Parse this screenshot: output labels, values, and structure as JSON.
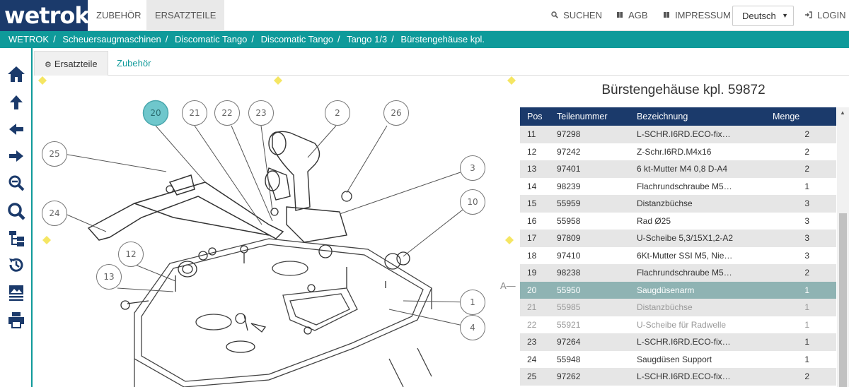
{
  "header": {
    "logo": "wetrok",
    "logo_mark": "®",
    "nav": [
      {
        "label": "ZUBEHÖR",
        "active": false
      },
      {
        "label": "ERSATZTEILE",
        "active": true
      }
    ],
    "links": [
      {
        "label": "SUCHEN",
        "icon": "search-icon"
      },
      {
        "label": "AGB",
        "icon": "book-icon"
      },
      {
        "label": "IMPRESSUM",
        "icon": "book-icon"
      },
      {
        "label": "LOGIN",
        "icon": "login-icon"
      }
    ],
    "language": "Deutsch"
  },
  "breadcrumb": [
    "WETROK",
    "Scheuersaugmaschinen",
    "Discomatic Tango",
    "Discomatic Tango",
    "Tango 1/3",
    "Bürstengehäuse kpl."
  ],
  "sidebar_icons": [
    "home-icon",
    "arrow-up-icon",
    "arrow-left-icon",
    "arrow-right-icon",
    "zoom-out-icon",
    "zoom-in-icon",
    "tree-icon",
    "history-icon",
    "image-list-icon",
    "print-icon"
  ],
  "subtabs": [
    {
      "label": "Ersatzteile",
      "icon": "gear-icon",
      "active": true
    },
    {
      "label": "Zubehör",
      "active": false
    }
  ],
  "drawing": {
    "callouts": [
      "20",
      "21",
      "22",
      "23",
      "2",
      "26",
      "25",
      "3",
      "24",
      "10",
      "12",
      "13",
      "1",
      "4"
    ],
    "selected": "20",
    "side_marker": "A—"
  },
  "parts": {
    "title": "Bürstengehäuse kpl. 59872",
    "columns": [
      "Pos",
      "Teilenummer",
      "Bezeichnung",
      "Menge"
    ],
    "rows": [
      {
        "pos": "11",
        "nr": "97298",
        "name": "L-SCHR.I6RD.ECO-fix…",
        "qty": "2",
        "state": "normal"
      },
      {
        "pos": "12",
        "nr": "97242",
        "name": "Z-Schr.I6RD.M4x16",
        "qty": "2",
        "state": "normal"
      },
      {
        "pos": "13",
        "nr": "97401",
        "name": "6 kt-Mutter M4 0,8 D-A4",
        "qty": "2",
        "state": "normal"
      },
      {
        "pos": "14",
        "nr": "98239",
        "name": "Flachrundschraube M5…",
        "qty": "1",
        "state": "normal"
      },
      {
        "pos": "15",
        "nr": "55959",
        "name": "Distanzbüchse",
        "qty": "3",
        "state": "normal"
      },
      {
        "pos": "16",
        "nr": "55958",
        "name": "Rad Ø25",
        "qty": "3",
        "state": "normal"
      },
      {
        "pos": "17",
        "nr": "97809",
        "name": "U-Scheibe 5,3/15X1,2-A2",
        "qty": "3",
        "state": "normal"
      },
      {
        "pos": "18",
        "nr": "97410",
        "name": "6Kt-Mutter SSI M5, Nie…",
        "qty": "3",
        "state": "normal"
      },
      {
        "pos": "19",
        "nr": "98238",
        "name": "Flachrundschraube M5…",
        "qty": "2",
        "state": "normal"
      },
      {
        "pos": "20",
        "nr": "55950",
        "name": "Saugdüsenarm",
        "qty": "1",
        "state": "selected"
      },
      {
        "pos": "21",
        "nr": "55985",
        "name": "Distanzbüchse",
        "qty": "1",
        "state": "dim"
      },
      {
        "pos": "22",
        "nr": "55921",
        "name": "U-Scheibe für Radwelle",
        "qty": "1",
        "state": "dim"
      },
      {
        "pos": "23",
        "nr": "97264",
        "name": "L-SCHR.I6RD.ECO-fix…",
        "qty": "1",
        "state": "normal"
      },
      {
        "pos": "24",
        "nr": "55948",
        "name": "Saugdüsen Support",
        "qty": "1",
        "state": "normal"
      },
      {
        "pos": "25",
        "nr": "97262",
        "name": "L-SCHR.I6RD.ECO-fix…",
        "qty": "2",
        "state": "normal"
      }
    ]
  },
  "colors": {
    "brand_navy": "#1b3a6b",
    "teal": "#0f9a9a",
    "selected_row": "#8fb3b3",
    "callout_selected": "#6fc7cc",
    "marker_yellow": "#f5e663"
  }
}
